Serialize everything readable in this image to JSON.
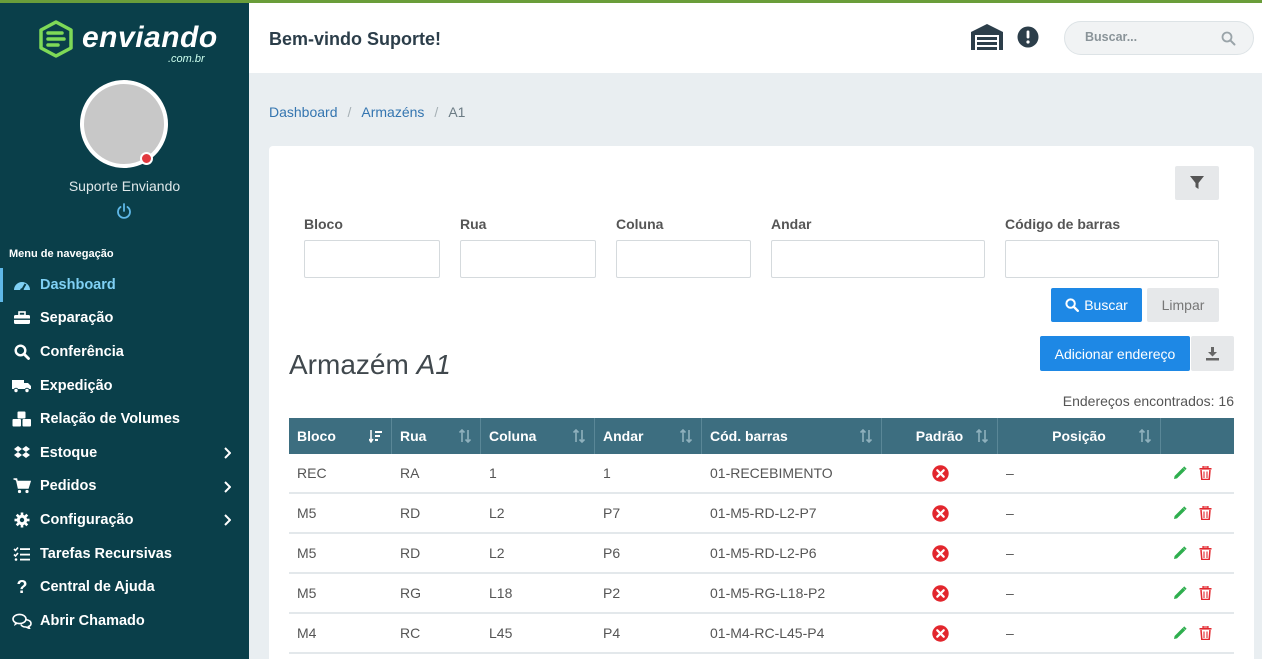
{
  "brand": {
    "name": "enviando",
    "sub": ".com.br",
    "accent": "#7ed957"
  },
  "user": {
    "name": "Suporte Enviando",
    "status_color": "#e2393f"
  },
  "nav": {
    "title": "Menu de navegação",
    "items": [
      {
        "label": "Dashboard",
        "icon": "dashboard-gauge-icon",
        "active": true
      },
      {
        "label": "Separação",
        "icon": "toolbox-icon"
      },
      {
        "label": "Conferência",
        "icon": "search-icon"
      },
      {
        "label": "Expedição",
        "icon": "truck-icon"
      },
      {
        "label": "Relação de Volumes",
        "icon": "boxes-icon"
      },
      {
        "label": "Estoque",
        "icon": "dropbox-icon",
        "submenu": true
      },
      {
        "label": "Pedidos",
        "icon": "cart-icon",
        "submenu": true
      },
      {
        "label": "Configuração",
        "icon": "gear-icon",
        "submenu": true
      },
      {
        "label": "Tarefas Recursivas",
        "icon": "tasks-icon"
      },
      {
        "label": "Central de Ajuda",
        "icon": "question-icon"
      },
      {
        "label": "Abrir Chamado",
        "icon": "chat-icon"
      }
    ]
  },
  "header": {
    "welcome": "Bem-vindo Suporte!",
    "search_placeholder": "Buscar..."
  },
  "breadcrumb": {
    "items": [
      "Dashboard",
      "Armazéns",
      "A1"
    ]
  },
  "filters": {
    "bloco": "Bloco",
    "rua": "Rua",
    "coluna": "Coluna",
    "andar": "Andar",
    "codigo": "Código de barras",
    "buscar": "Buscar",
    "limpar": "Limpar"
  },
  "page": {
    "title_prefix": "Armazém",
    "title_name": "A1",
    "add_button": "Adicionar endereço",
    "count_text": "Endereços encontrados: 16"
  },
  "table": {
    "columns": [
      "Bloco",
      "Rua",
      "Coluna",
      "Andar",
      "Cód. barras",
      "Padrão",
      "Posição"
    ],
    "rows": [
      {
        "bloco": "REC",
        "rua": "RA",
        "coluna": "1",
        "andar": "1",
        "codigo": "01-RECEBIMENTO",
        "posicao": "–"
      },
      {
        "bloco": "M5",
        "rua": "RD",
        "coluna": "L2",
        "andar": "P7",
        "codigo": "01-M5-RD-L2-P7",
        "posicao": "–"
      },
      {
        "bloco": "M5",
        "rua": "RD",
        "coluna": "L2",
        "andar": "P6",
        "codigo": "01-M5-RD-L2-P6",
        "posicao": "–"
      },
      {
        "bloco": "M5",
        "rua": "RG",
        "coluna": "L18",
        "andar": "P2",
        "codigo": "01-M5-RG-L18-P2",
        "posicao": "–"
      },
      {
        "bloco": "M4",
        "rua": "RC",
        "coluna": "L45",
        "andar": "P4",
        "codigo": "01-M4-RC-L45-P4",
        "posicao": "–"
      }
    ]
  },
  "colors": {
    "sidebar": "#0a3f4a",
    "primary": "#1e88e5",
    "table_header": "#3d6e80",
    "danger": "#e2262d",
    "edit": "#2eae4e"
  }
}
